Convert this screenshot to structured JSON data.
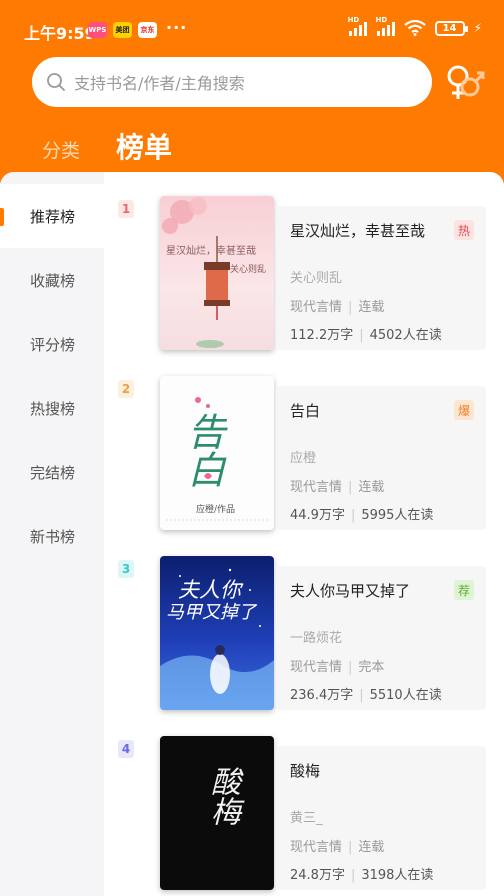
{
  "status": {
    "time": "上午9:59",
    "app_icons": [
      "wps-icon",
      "meituan-icon",
      "jd-icon"
    ],
    "app_icon_texts": [
      "WPS",
      "美团",
      "京东"
    ],
    "more": "···",
    "signal1_label": "HD",
    "signal2_label": "HD",
    "battery": "14"
  },
  "search": {
    "placeholder": "支持书名/作者/主角搜索"
  },
  "tabs": {
    "classify": "分类",
    "rank": "榜单"
  },
  "sidebar": {
    "items": [
      {
        "label": "推荐榜",
        "active": true
      },
      {
        "label": "收藏榜",
        "active": false
      },
      {
        "label": "评分榜",
        "active": false
      },
      {
        "label": "热搜榜",
        "active": false
      },
      {
        "label": "完结榜",
        "active": false
      },
      {
        "label": "新书榜",
        "active": false
      }
    ]
  },
  "books": [
    {
      "rank": "1",
      "rank_color": "#e86a6a",
      "rank_bg": "#fde8e8",
      "title": "星汉灿烂，幸甚至哉",
      "badge": "热",
      "badge_color": "#e8464e",
      "badge_bg": "#fde2e2",
      "author": "关心则乱",
      "category": "现代言情",
      "status": "连载",
      "words": "112.2万字",
      "readers": "4502人在读",
      "cover_line1": "星汉灿烂，幸甚至哉",
      "cover_line2": "关心则乱"
    },
    {
      "rank": "2",
      "rank_color": "#e8a24c",
      "rank_bg": "#fdf0dc",
      "title": "告白",
      "badge": "爆",
      "badge_color": "#f07f2b",
      "badge_bg": "#fde6cf",
      "author": "应橙",
      "category": "现代言情",
      "status": "连载",
      "words": "44.9万字",
      "readers": "5995人在读",
      "cover_line1": "告白",
      "cover_line2": "应橙/作品"
    },
    {
      "rank": "3",
      "rank_color": "#3cc8c8",
      "rank_bg": "#dcf7f6",
      "title": "夫人你马甲又掉了",
      "badge": "荐",
      "badge_color": "#5cae3b",
      "badge_bg": "#dff3d5",
      "author": "一路烦花",
      "category": "现代言情",
      "status": "完本",
      "words": "236.4万字",
      "readers": "5510人在读",
      "cover_line1": "夫人你",
      "cover_line2": "马甲又掉了"
    },
    {
      "rank": "4",
      "rank_color": "#6a6adc",
      "rank_bg": "#e8e8fb",
      "title": "酸梅",
      "badge": "",
      "badge_color": "#999",
      "badge_bg": "transparent",
      "author": "黄三_",
      "category": "现代言情",
      "status": "连载",
      "words": "24.8万字",
      "readers": "3198人在读",
      "cover_line1": "酸梅",
      "cover_line2": ""
    }
  ]
}
